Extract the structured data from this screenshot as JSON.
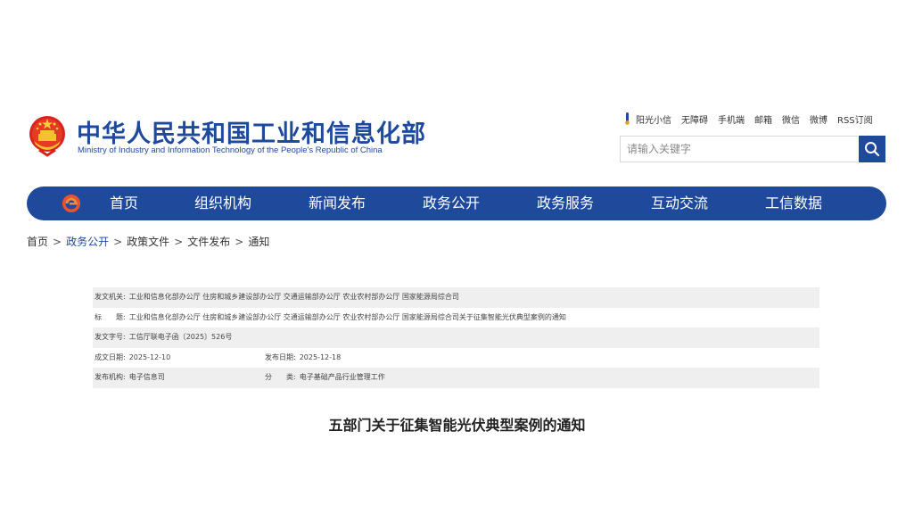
{
  "header": {
    "title_cn": "中华人民共和国工业和信息化部",
    "title_en": "Ministry of Industry and Information Technology of the People's Republic of China",
    "emblem_icon": "national-emblem-icon",
    "top_links": [
      "阳光小信",
      "无障碍",
      "手机端",
      "邮箱",
      "微信",
      "微博",
      "RSS订阅"
    ],
    "search": {
      "placeholder": "请输入关键字",
      "button_icon": "search-icon"
    }
  },
  "colors": {
    "brand_blue": "#1f4a9c",
    "row_shade": "#efefef"
  },
  "nav": {
    "logo_icon": "miit-logo-icon",
    "items": [
      "首页",
      "组织机构",
      "新闻发布",
      "政务公开",
      "政务服务",
      "互动交流",
      "工信数据"
    ]
  },
  "breadcrumb": {
    "items": [
      "首页",
      "政务公开",
      "政策文件",
      "文件发布",
      "通知"
    ],
    "separator": ">"
  },
  "document": {
    "issuer_label": "发文机关:",
    "issuer": "工业和信息化部办公厅 住房和城乡建设部办公厅 交通运输部办公厅 农业农村部办公厅 国家能源局综合司",
    "title_label": "标　　题:",
    "title_full": "工业和信息化部办公厅 住房和城乡建设部办公厅 交通运输部办公厅 农业农村部办公厅 国家能源局综合司关于征集智能光伏典型案例的通知",
    "doc_no_label": "发文字号:",
    "doc_no": "工信厅联电子函〔2025〕526号",
    "created_label": "成文日期:",
    "created": "2025-12-10",
    "published_label": "发布日期:",
    "published": "2025-12-18",
    "org_label": "发布机构:",
    "org": "电子信息司",
    "category_label": "分　　类:",
    "category": "电子基础产品行业管理工作",
    "heading": "五部门关于征集智能光伏典型案例的通知"
  }
}
